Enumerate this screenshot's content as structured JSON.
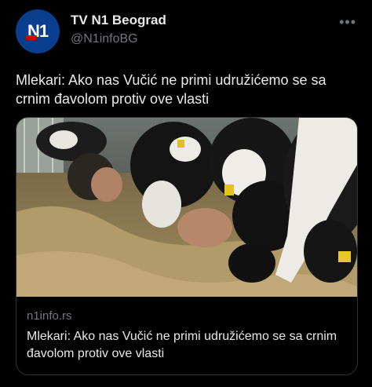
{
  "account": {
    "avatar_text": "N1",
    "name": "TV N1 Beograd",
    "handle": "@N1infoBG"
  },
  "more_icon": "more-horizontal-icon",
  "tweet": {
    "text": "Mlekari: Ako nas Vučić ne primi udružićemo se sa crnim đavolom protiv ove vlasti"
  },
  "link_card": {
    "domain": "n1info.rs",
    "title": "Mlekari: Ako nas Vučić ne primi udružićemo se sa crnim đavolom protiv ove vlasti"
  },
  "colors": {
    "background": "#000000",
    "text": "#e7e9ea",
    "secondary": "#71767b",
    "border": "#2f3336",
    "avatar_bg": "#0a3f8f"
  }
}
